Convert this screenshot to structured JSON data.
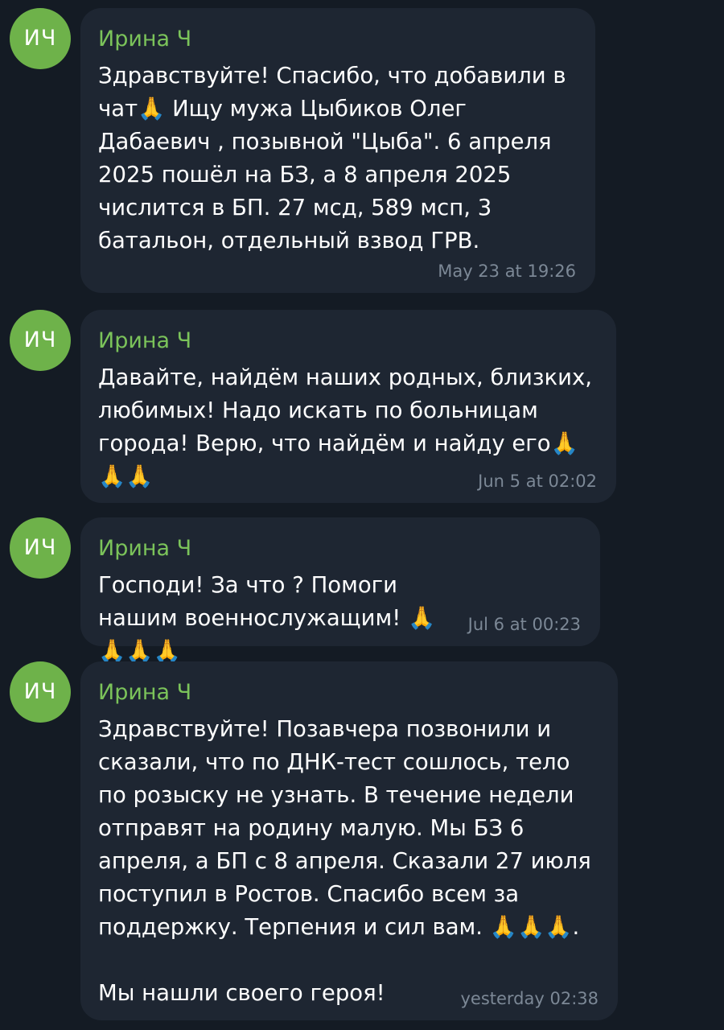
{
  "messages": [
    {
      "avatar": "ИЧ",
      "sender": "Ирина Ч",
      "text": "Здравствуйте! Спасибо, что добавили в чат🙏 Ищу мужа Цыбиков Олег Дабаевич , позывной \"Цыба\". 6 апреля 2025 пошёл на БЗ, а 8 апреля 2025 числится в БП. 27 мсд, 589 мсп, 3 батальон, отдельный взвод ГРВ.",
      "time": "May 23 at 19:26"
    },
    {
      "avatar": "ИЧ",
      "sender": "Ирина Ч",
      "text": "Давайте, найдём наших родных, близких, любимых! Надо искать по больницам города! Верю, что найдём и найду его🙏🙏🙏",
      "time": "Jun 5 at 02:02"
    },
    {
      "avatar": "ИЧ",
      "sender": "Ирина Ч",
      "text": "Господи! За что ? Помоги нашим военнослужащим! 🙏🙏🙏🙏",
      "time": "Jul 6 at 00:23"
    },
    {
      "avatar": "ИЧ",
      "sender": "Ирина Ч",
      "text": "Здравствуйте! Позавчера позвонили и сказали, что по ДНК-тест сошлось, тело по розыску не узнать. В течение недели отправят на родину малую. Мы БЗ 6 апреля, а БП с 8 апреля. Сказали 27 июля поступил в Ростов. Спасибо всем за поддержку. Терпения и сил вам. 🙏🙏🙏.\n\nМы нашли своего героя!",
      "time": "yesterday 02:38"
    }
  ]
}
